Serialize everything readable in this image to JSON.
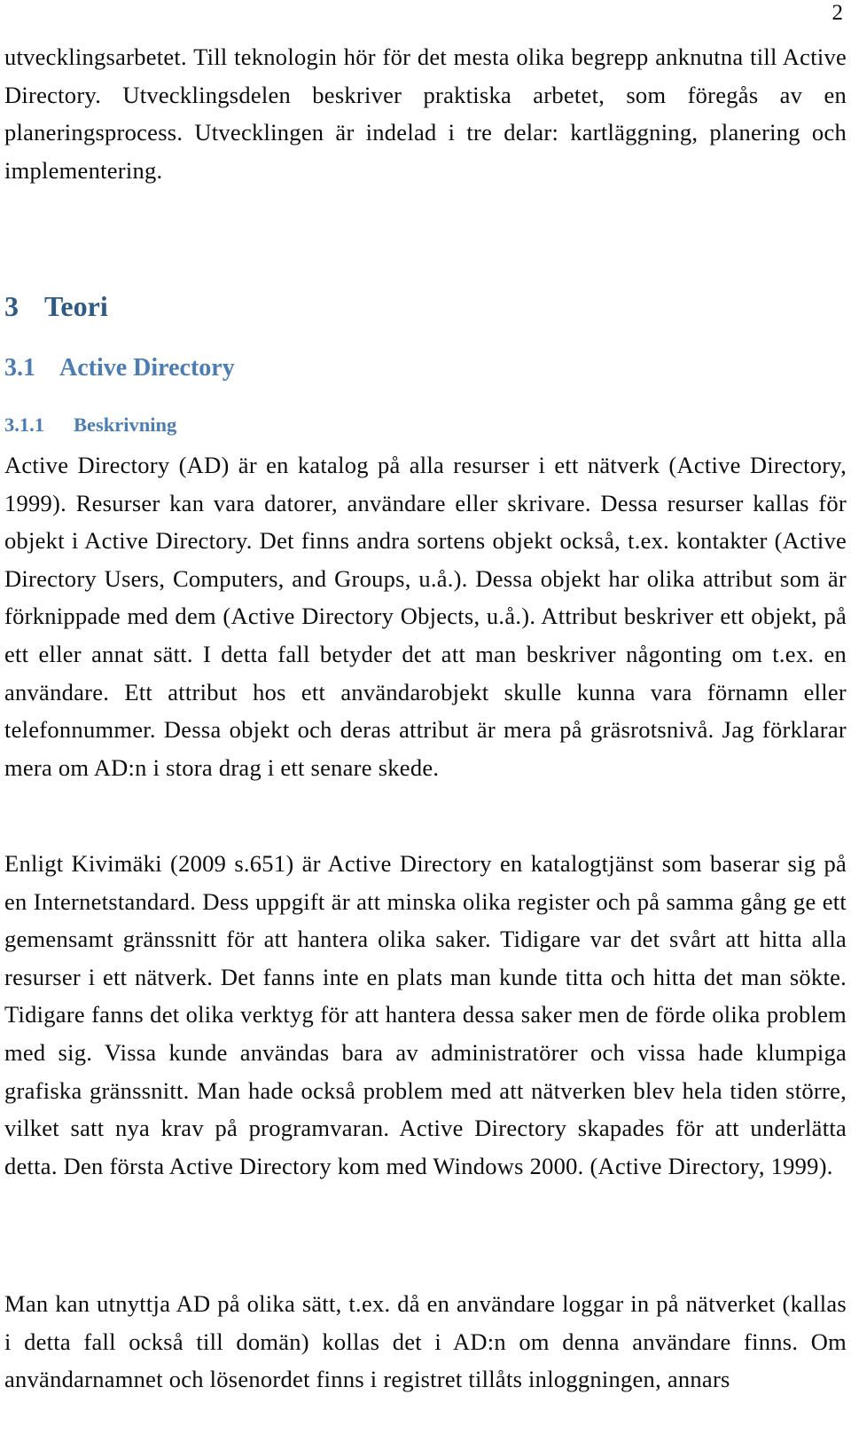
{
  "document": {
    "language": "sv",
    "page_number": "2"
  },
  "paragraphs": {
    "continued": "utvecklingsarbetet. Till teknologin hör för det mesta olika begrepp anknutna till Active Directory. Utvecklingsdelen beskriver praktiska arbetet, som föregås av en planeringsprocess. Utvecklingen är indelad i tre delar: kartläggning, planering och implementering.",
    "beskrivning": "Active Directory (AD) är en katalog på alla resurser i ett nätverk (Active Directory, 1999). Resurser kan vara datorer, användare eller skrivare. Dessa resurser kallas för objekt i Active Directory. Det finns andra sortens objekt också, t.ex. kontakter (Active Directory Users, Computers, and Groups, u.å.). Dessa objekt har olika attribut som är förknippade med dem (Active Directory Objects, u.å.). Attribut beskriver ett objekt, på ett eller annat sätt. I detta fall betyder det att man beskriver någonting om t.ex. en användare. Ett attribut hos ett användarobjekt skulle kunna vara förnamn eller telefonnummer. Dessa objekt och deras attribut är mera på gräsrotsnivå. Jag förklarar mera om AD:n i stora drag i ett senare skede.",
    "kivimaki": "Enligt Kivimäki (2009 s.651) är Active Directory en katalogtjänst som baserar sig på en Internetstandard. Dess uppgift är att minska olika register och på samma gång ge ett gemensamt gränssnitt för att hantera olika saker. Tidigare var det svårt att hitta alla resurser i ett nätverk. Det fanns inte en plats man kunde titta och hitta det man sökte. Tidigare fanns det olika verktyg för att hantera dessa saker men de förde olika problem med sig. Vissa kunde användas bara av administratörer och vissa hade klumpiga grafiska gränssnitt. Man hade också problem med att nätverken blev hela tiden större, vilket satt nya krav på programvaran. Active Directory skapades för att underlätta detta. Den första Active Directory kom med Windows 2000. (Active Directory, 1999).",
    "utnyttja": "Man kan utnyttja AD på olika sätt, t.ex. då en användare loggar in på nätverket (kallas i detta fall också till domän) kollas det i AD:n om denna användare finns. Om användarnamnet och lösenordet finns i registret tillåts inloggningen, annars"
  },
  "headings": {
    "h1": {
      "number": "3",
      "title": "Teori",
      "color": "#2e5a85"
    },
    "h2": {
      "number": "3.1",
      "title": "Active Directory",
      "color": "#4b7cb4"
    },
    "h3": {
      "number": "3.1.1",
      "title": "Beskrivning",
      "color": "#4b7cb4"
    }
  }
}
